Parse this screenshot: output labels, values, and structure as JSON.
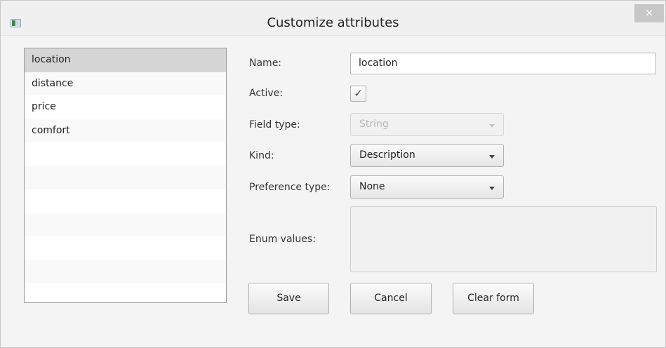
{
  "window": {
    "title": "Customize attributes",
    "close_glyph": "×",
    "app_icon": "window-icon"
  },
  "attribute_list": {
    "items": [
      "location",
      "distance",
      "price",
      "comfort"
    ],
    "selected": "location"
  },
  "form": {
    "name_label": "Name:",
    "name_value": "location",
    "active_label": "Active:",
    "active_checked": true,
    "active_check_glyph": "✓",
    "field_type_label": "Field type:",
    "field_type_value": "String",
    "kind_label": "Kind:",
    "kind_value": "Description",
    "preference_type_label": "Preference type:",
    "preference_type_value": "None",
    "enum_values_label": "Enum values:",
    "enum_values_value": ""
  },
  "buttons": {
    "save": "Save",
    "cancel": "Cancel",
    "clear_form": "Clear form"
  },
  "colors": {
    "selected_row": "#d6d6d6",
    "window_bg": "#f4f4f4"
  }
}
